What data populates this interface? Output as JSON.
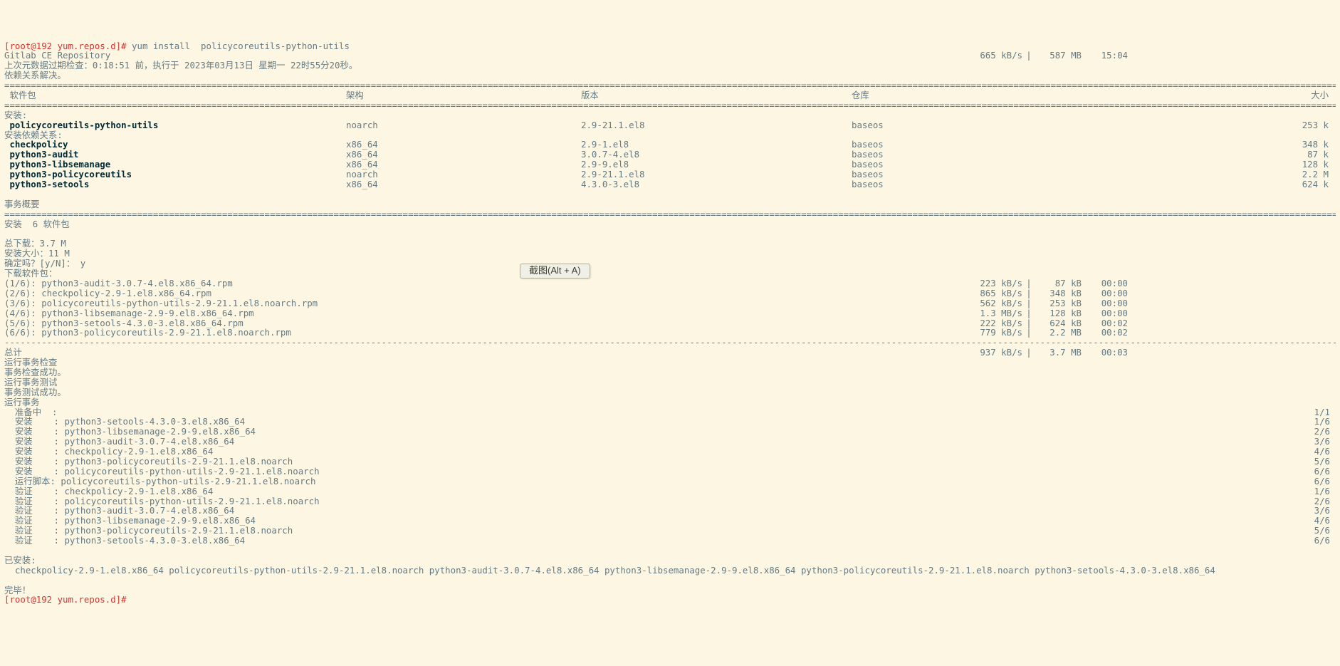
{
  "prompt1_path": "[root@192 yum.repos.d]# ",
  "prompt1_cmd": "yum install  policycoreutils-python-utils",
  "repo_line": "Gitlab CE Repository",
  "repo_speed": "665 kB/s",
  "repo_size": "587 MB",
  "repo_time": "15:04",
  "meta_line": "上次元数据过期检查：0:18:51 前，执行于 2023年03月13日 星期一 22时55分20秒。",
  "deps_solved": "依赖关系解决。",
  "hr": "================================================================================================================================================================================================================================================================",
  "hr_dash": "----------------------------------------------------------------------------------------------------------------------------------------------------------------------------------------------------------------------------------------------------------------",
  "header": {
    "pkg": " 软件包",
    "arch": "架构",
    "ver": "版本",
    "repo": "仓库",
    "size": "大小"
  },
  "install_hdr": "安装:",
  "install_pkg": {
    "name": " policycoreutils-python-utils",
    "arch": "noarch",
    "ver": "2.9-21.1.el8",
    "repo": "baseos",
    "size": "253 k"
  },
  "dep_hdr": "安装依赖关系:",
  "deps": [
    {
      "name": " checkpolicy",
      "arch": "x86_64",
      "ver": "2.9-1.el8",
      "repo": "baseos",
      "size": "348 k"
    },
    {
      "name": " python3-audit",
      "arch": "x86_64",
      "ver": "3.0.7-4.el8",
      "repo": "baseos",
      "size": "87 k"
    },
    {
      "name": " python3-libsemanage",
      "arch": "x86_64",
      "ver": "2.9-9.el8",
      "repo": "baseos",
      "size": "128 k"
    },
    {
      "name": " python3-policycoreutils",
      "arch": "noarch",
      "ver": "2.9-21.1.el8",
      "repo": "baseos",
      "size": "2.2 M"
    },
    {
      "name": " python3-setools",
      "arch": "x86_64",
      "ver": "4.3.0-3.el8",
      "repo": "baseos",
      "size": "624 k"
    }
  ],
  "summary_hdr": "事务概要",
  "summary_line": "安装  6 软件包",
  "total_dl": "总下载：3.7 M",
  "install_size": "安装大小：11 M",
  "confirm": "确定吗？[y/N]： y",
  "dl_hdr": "下载软件包：",
  "downloads": [
    {
      "l": "(1/6): python3-audit-3.0.7-4.el8.x86_64.rpm",
      "sp": "223 kB/s",
      "sz": "87 kB",
      "t": "00:00"
    },
    {
      "l": "(2/6): checkpolicy-2.9-1.el8.x86_64.rpm",
      "sp": "865 kB/s",
      "sz": "348 kB",
      "t": "00:00"
    },
    {
      "l": "(3/6): policycoreutils-python-utils-2.9-21.1.el8.noarch.rpm",
      "sp": "562 kB/s",
      "sz": "253 kB",
      "t": "00:00"
    },
    {
      "l": "(4/6): python3-libsemanage-2.9-9.el8.x86_64.rpm",
      "sp": "1.3 MB/s",
      "sz": "128 kB",
      "t": "00:00"
    },
    {
      "l": "(5/6): python3-setools-4.3.0-3.el8.x86_64.rpm",
      "sp": "222 kB/s",
      "sz": "624 kB",
      "t": "00:02"
    },
    {
      "l": "(6/6): python3-policycoreutils-2.9-21.1.el8.noarch.rpm",
      "sp": "779 kB/s",
      "sz": "2.2 MB",
      "t": "00:02"
    }
  ],
  "total_row": {
    "l": "总计",
    "sp": "937 kB/s",
    "sz": "3.7 MB",
    "t": "00:03"
  },
  "trans_check": "运行事务检查",
  "trans_check_ok": "事务检查成功。",
  "trans_test": "运行事务测试",
  "trans_test_ok": "事务测试成功。",
  "trans_run": "运行事务",
  "tasks": [
    {
      "l": "  准备中  :",
      "r": "1/1"
    },
    {
      "l": "  安装    : python3-setools-4.3.0-3.el8.x86_64",
      "r": "1/6"
    },
    {
      "l": "  安装    : python3-libsemanage-2.9-9.el8.x86_64",
      "r": "2/6"
    },
    {
      "l": "  安装    : python3-audit-3.0.7-4.el8.x86_64",
      "r": "3/6"
    },
    {
      "l": "  安装    : checkpolicy-2.9-1.el8.x86_64",
      "r": "4/6"
    },
    {
      "l": "  安装    : python3-policycoreutils-2.9-21.1.el8.noarch",
      "r": "5/6"
    },
    {
      "l": "  安装    : policycoreutils-python-utils-2.9-21.1.el8.noarch",
      "r": "6/6"
    },
    {
      "l": "  运行脚本: policycoreutils-python-utils-2.9-21.1.el8.noarch",
      "r": "6/6"
    },
    {
      "l": "  验证    : checkpolicy-2.9-1.el8.x86_64",
      "r": "1/6"
    },
    {
      "l": "  验证    : policycoreutils-python-utils-2.9-21.1.el8.noarch",
      "r": "2/6"
    },
    {
      "l": "  验证    : python3-audit-3.0.7-4.el8.x86_64",
      "r": "3/6"
    },
    {
      "l": "  验证    : python3-libsemanage-2.9-9.el8.x86_64",
      "r": "4/6"
    },
    {
      "l": "  验证    : python3-policycoreutils-2.9-21.1.el8.noarch",
      "r": "5/6"
    },
    {
      "l": "  验证    : python3-setools-4.3.0-3.el8.x86_64",
      "r": "6/6"
    }
  ],
  "installed_hdr": "已安装:",
  "installed_line": "  checkpolicy-2.9-1.el8.x86_64 policycoreutils-python-utils-2.9-21.1.el8.noarch python3-audit-3.0.7-4.el8.x86_64 python3-libsemanage-2.9-9.el8.x86_64 python3-policycoreutils-2.9-21.1.el8.noarch python3-setools-4.3.0-3.el8.x86_64",
  "done": "完毕！",
  "prompt2_path": "[root@192 yum.repos.d]# ",
  "tooltip": "截图(Alt + A)"
}
